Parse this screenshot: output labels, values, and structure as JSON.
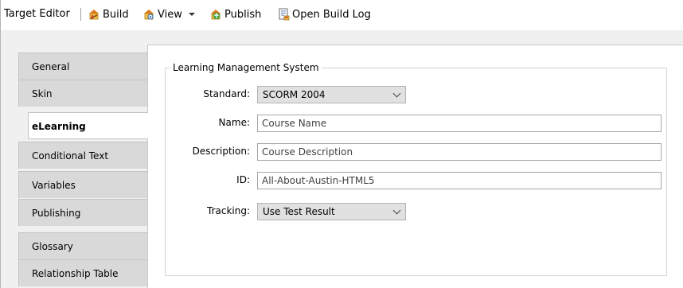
{
  "toolbar": {
    "title": "Target Editor",
    "build_label": "Build",
    "view_label": "View",
    "publish_label": "Publish",
    "open_build_log_label": "Open Build Log"
  },
  "tabs": [
    {
      "label": "General"
    },
    {
      "label": "Skin"
    },
    {
      "label": "eLearning",
      "active": true
    },
    {
      "label": "Conditional Text"
    },
    {
      "label": "Variables"
    },
    {
      "label": "Publishing"
    },
    {
      "label": "Glossary"
    },
    {
      "label": "Relationship Table"
    }
  ],
  "lms": {
    "group_title": "Learning Management System",
    "standard": {
      "label": "Standard:",
      "value": "SCORM 2004"
    },
    "name": {
      "label": "Name:",
      "placeholder": "Course Name"
    },
    "description": {
      "label": "Description:",
      "placeholder": "Course Description"
    },
    "id": {
      "label": "ID:",
      "value": "All-About-Austin-HTML5"
    },
    "tracking": {
      "label": "Tracking:",
      "value": "Use Test Result"
    }
  },
  "colors": {
    "accent_active_tab": "#ffffff",
    "tab_inactive": "#d9d9d9",
    "toolbar_bg": "#ffffff",
    "panel_bg": "#f0f0f0"
  },
  "icons": [
    "build-icon",
    "view-icon",
    "publish-icon",
    "build-log-icon",
    "chevron-down-icon"
  ]
}
